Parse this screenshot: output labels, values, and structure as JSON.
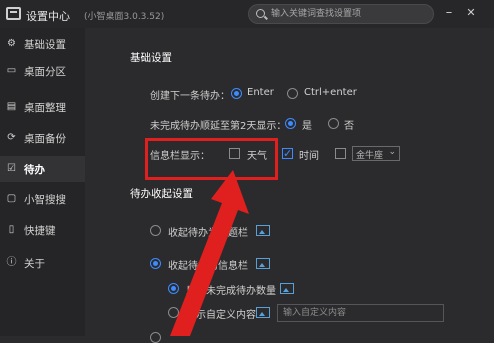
{
  "titlebar": {
    "title": "设置中心",
    "version": "(小智桌面3.0.3.52)",
    "search_placeholder": "输入关键词查找设置项",
    "minimize": "–",
    "close": "✕"
  },
  "sidebar": {
    "items": [
      {
        "label": "基础设置",
        "icon": "gear-icon"
      },
      {
        "label": "桌面分区",
        "icon": "monitor-icon"
      },
      {
        "label": "桌面整理",
        "icon": "organize-icon"
      },
      {
        "label": "桌面备份",
        "icon": "backup-icon"
      },
      {
        "label": "待办",
        "icon": "todo-icon",
        "active": true
      },
      {
        "label": "小智搜搜",
        "icon": "search-box-icon"
      },
      {
        "label": "快捷键",
        "icon": "mouse-icon"
      },
      {
        "label": "关于",
        "icon": "info-icon"
      }
    ]
  },
  "basic": {
    "section_title": "基础设置",
    "create_label": "创建下一条待办：",
    "create_opt1": "Enter",
    "create_opt2": "Ctrl+enter",
    "overdue_label": "未完成待办顺延至第2天显示：",
    "overdue_yes": "是",
    "overdue_no": "否",
    "infobar_label": "信息栏显示：",
    "weather_label": "天气",
    "time_label": "时间",
    "zodiac_value": "金牛座"
  },
  "collapse": {
    "section_title": "待办收起设置",
    "opt1": "收起待办为标题栏",
    "opt2": "收起待办为信息栏",
    "sub1": "显示未完成待办数量",
    "sub2": "显示自定义内容",
    "custom_placeholder": "输入自定义内容"
  },
  "colors": {
    "accent": "#3d8bff",
    "highlight": "#e0201e"
  }
}
